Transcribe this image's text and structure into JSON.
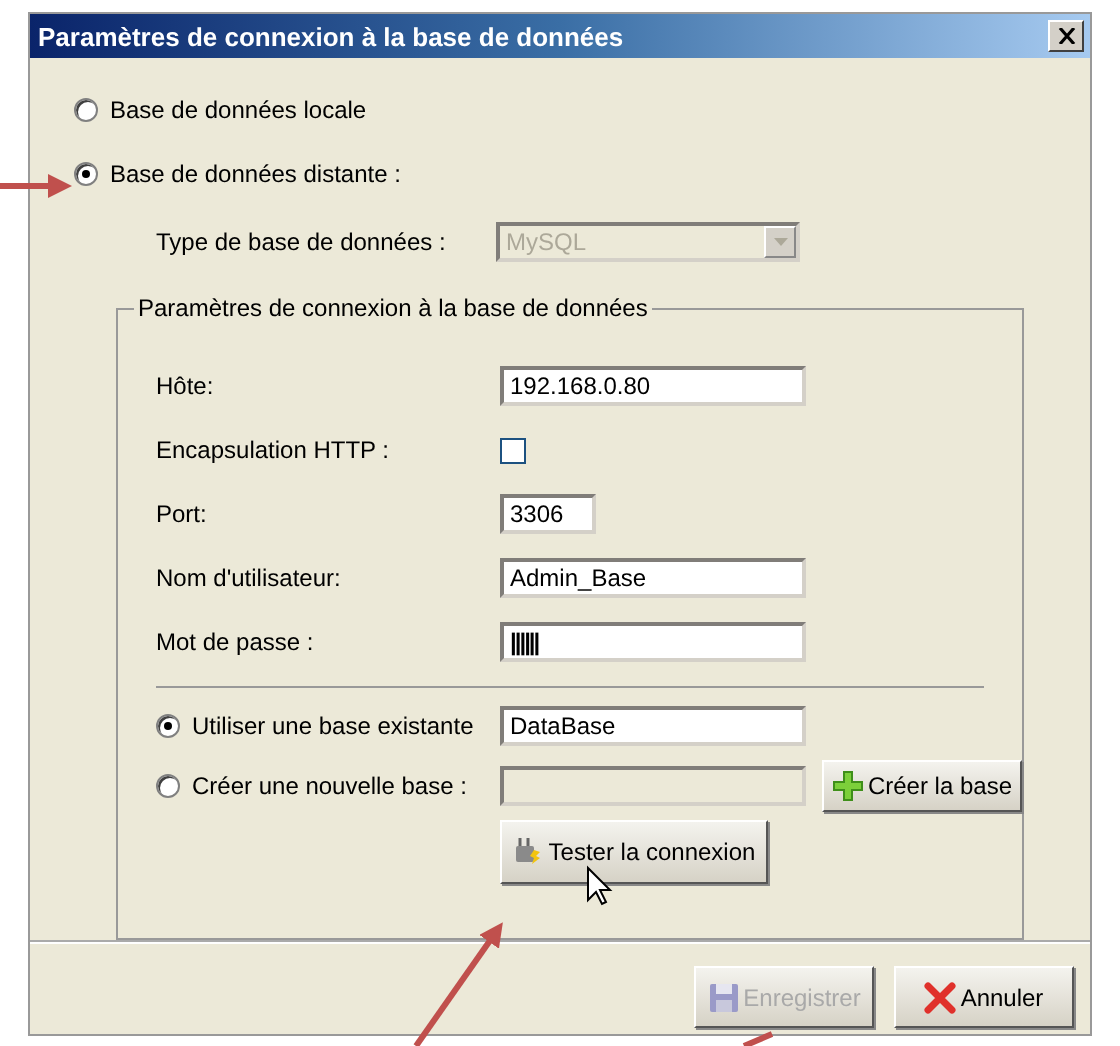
{
  "window": {
    "title": "Paramètres de connexion à la base de données"
  },
  "source_options": [
    {
      "label": "Base de données locale",
      "selected": false
    },
    {
      "label": "Base de données distante :",
      "selected": true
    }
  ],
  "database_type": {
    "label": "Type de base de données :",
    "value": "MySQL",
    "disabled": true
  },
  "group": {
    "title": "Paramètres de connexion à la base de données",
    "fields": [
      {
        "kind": "text",
        "label": "Hôte:",
        "value": "192.168.0.80"
      },
      {
        "kind": "checkbox",
        "label": "Encapsulation HTTP :",
        "checked": false
      },
      {
        "kind": "short",
        "label": "Port:",
        "value": "3306"
      },
      {
        "kind": "text",
        "label": "Nom d'utilisateur:",
        "value": "Admin_Base"
      },
      {
        "kind": "password",
        "label": "Mot de passe :",
        "value": "||||||"
      }
    ],
    "database_options": [
      {
        "label": "Utiliser une base existante",
        "selected": true,
        "value": "DataBase",
        "disabled": false
      },
      {
        "label": "Créer une nouvelle base :",
        "selected": false,
        "disabled": true
      }
    ],
    "create_button": {
      "label": "Créer la base"
    },
    "test_button": {
      "label": "Tester la connexion"
    }
  },
  "buttons": [
    {
      "kind": "save",
      "label": "Enregistrer",
      "disabled": true
    },
    {
      "kind": "cancel",
      "label": "Annuler",
      "disabled": false
    }
  ]
}
